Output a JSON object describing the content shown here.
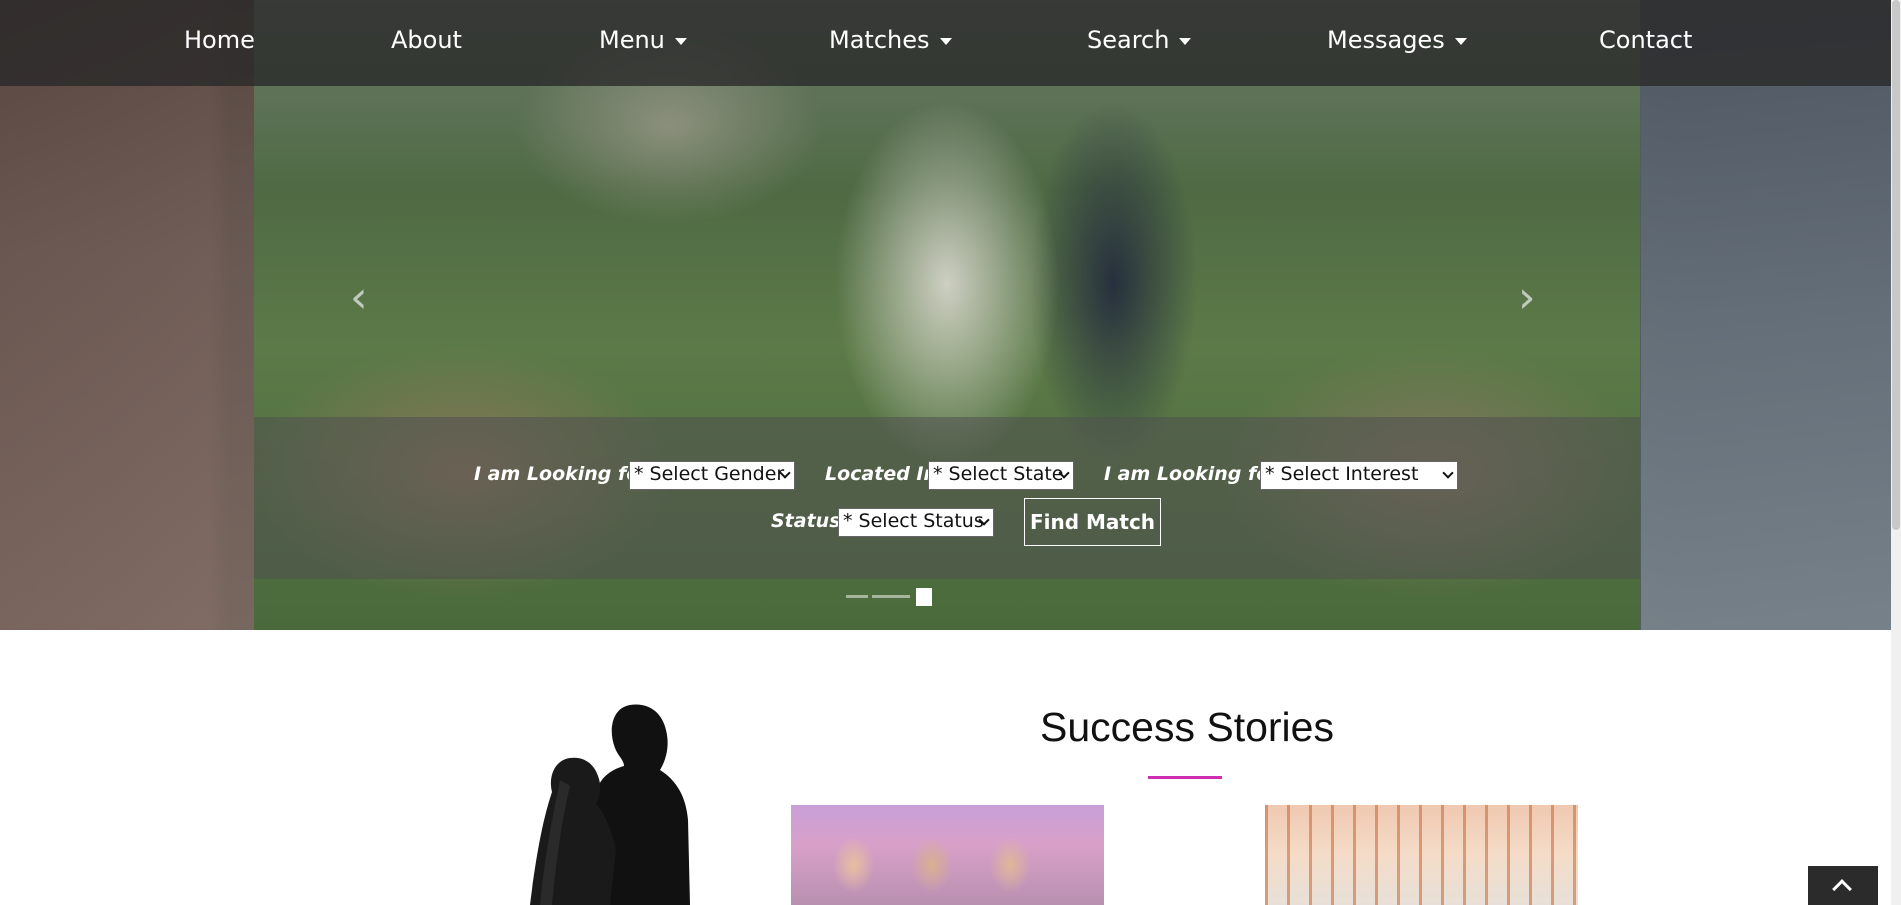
{
  "nav": {
    "items": [
      {
        "label": "Home",
        "has_dropdown": false
      },
      {
        "label": "About",
        "has_dropdown": false
      },
      {
        "label": "Menu",
        "has_dropdown": true
      },
      {
        "label": "Matches",
        "has_dropdown": true
      },
      {
        "label": "Search",
        "has_dropdown": true
      },
      {
        "label": "Messages",
        "has_dropdown": true
      },
      {
        "label": "Contact",
        "has_dropdown": false
      }
    ]
  },
  "carousel": {
    "prev_icon": "chevron-left-icon",
    "next_icon": "chevron-right-icon",
    "prev_glyph": "‹",
    "next_glyph": "›",
    "slide_count": 3,
    "active_slide": 3
  },
  "search_form": {
    "gender_label": "I am Looking for:",
    "gender_select": "* Select Gender",
    "state_label": "Located In:",
    "state_select": "* Select State",
    "interest_label": "I am Looking for:",
    "interest_select": "* Select Interest",
    "status_label": "Status:",
    "status_select": "* Select Status",
    "submit_label": "Find Match"
  },
  "success_stories": {
    "title": "Success Stories",
    "accent_color": "#d02eb0"
  },
  "back_to_top_icon": "chevron-up-icon"
}
